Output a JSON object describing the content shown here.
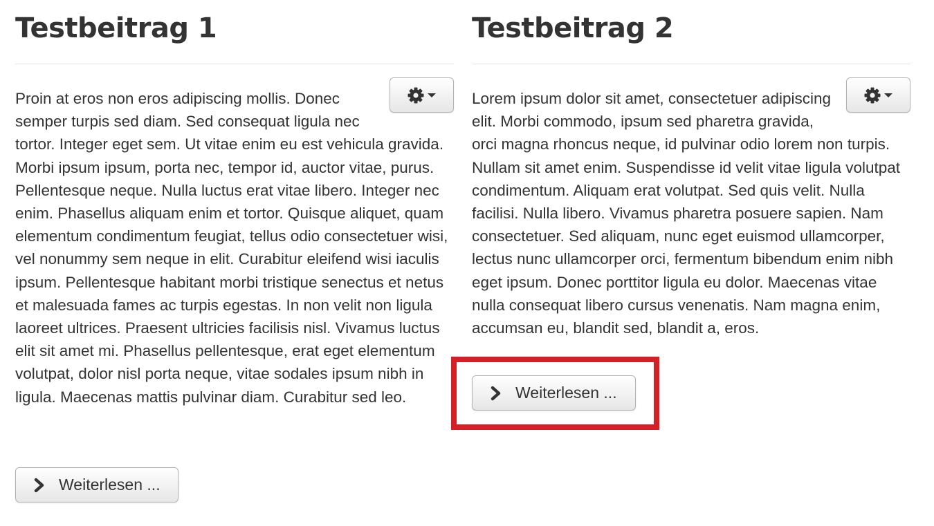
{
  "articles": [
    {
      "title": "Testbeitrag 1",
      "body": "Proin at eros non eros adipiscing mollis. Donec semper turpis sed diam. Sed consequat ligula nec tortor. Integer eget sem. Ut vitae enim eu est vehicula gravida. Morbi ipsum ipsum, porta nec, tempor id, auctor vitae, purus. Pellentesque neque. Nulla luctus erat vitae libero. Integer nec enim. Phasellus aliquam enim et tortor. Quisque aliquet, quam elementum condimentum feugiat, tellus odio consectetuer wisi, vel nonummy sem neque in elit. Curabitur eleifend wisi iaculis ipsum. Pellentesque habitant morbi tristique senectus et netus et malesuada fames ac turpis egestas. In non velit non ligula laoreet ultrices. Praesent ultricies facilisis nisl. Vivamus luctus elit sit amet mi. Phasellus pellentesque, erat eget elementum volutpat, dolor nisl porta neque, vitae sodales ipsum nibh in ligula. Maecenas mattis pulvinar diam. Curabitur sed leo.",
      "read_more_label": "Weiterlesen ...",
      "tools_icon": "gear-icon"
    },
    {
      "title": "Testbeitrag 2",
      "body": "Lorem ipsum dolor sit amet, consectetuer adipiscing elit. Morbi commodo, ipsum sed pharetra gravida, orci magna rhoncus neque, id pulvinar odio lorem non turpis. Nullam sit amet enim. Suspendisse id velit vitae ligula volutpat condimentum. Aliquam erat volutpat. Sed quis velit. Nulla facilisi. Nulla libero. Vivamus pharetra posuere sapien. Nam consectetuer. Sed aliquam, nunc eget euismod ullamcorper, lectus nunc ullamcorper orci, fermentum bibendum enim nibh eget ipsum. Donec porttitor ligula eu dolor. Maecenas vitae nulla consequat libero cursus venenatis. Nam magna enim, accumsan eu, blandit sed, blandit a, eros.",
      "read_more_label": "Weiterlesen ...",
      "tools_icon": "gear-icon"
    }
  ],
  "colors": {
    "text": "#333333",
    "divider": "#e5e5e5",
    "button_border": "#b3b3b3",
    "highlight": "#d62027"
  }
}
